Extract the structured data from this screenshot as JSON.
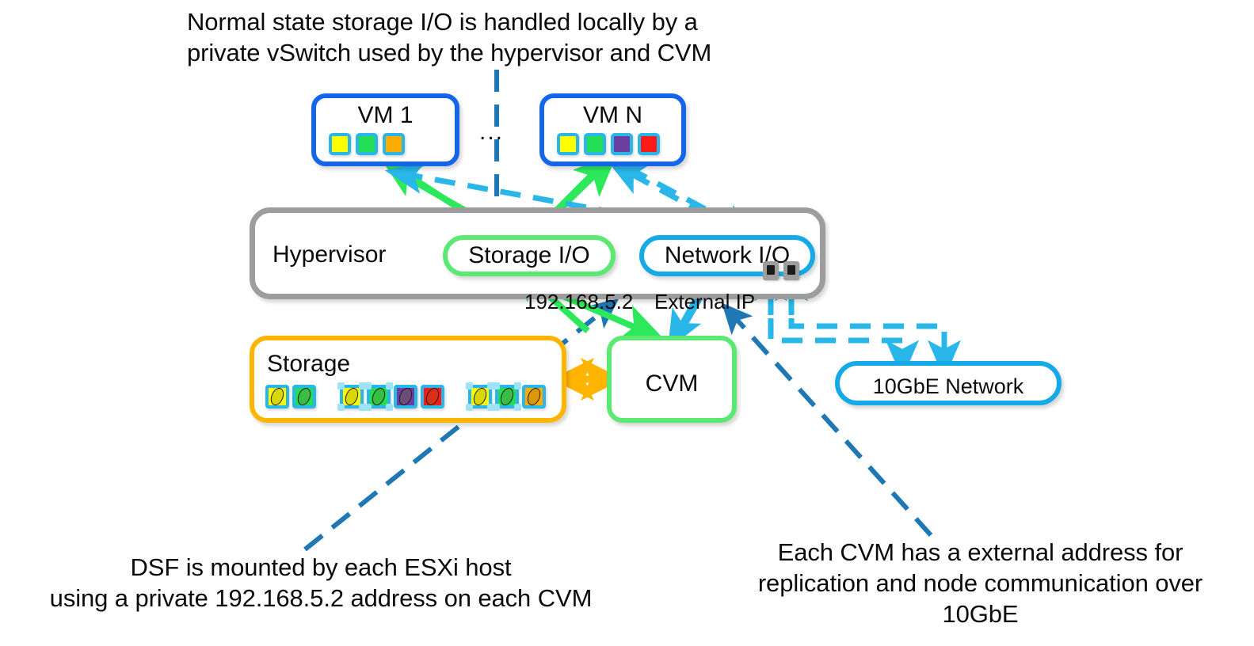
{
  "captions": {
    "top": "Normal state storage I/O is handled locally by a\nprivate vSwitch used by the hypervisor and CVM",
    "bottom_left": "DSF is mounted by each ESXi host\nusing a private 192.168.5.2 address on each CVM",
    "bottom_right": "Each CVM has a external address for\nreplication and node communication over\n10GbE"
  },
  "vms": [
    {
      "title": "VM 1",
      "chips": [
        "#FFFF00",
        "#22DD55",
        "#FFAA00"
      ]
    },
    {
      "title": "VM N",
      "chips": [
        "#FFFF00",
        "#22DD55",
        "#6B3FA0",
        "#FF1A1A"
      ]
    }
  ],
  "ellipsis": "...",
  "hypervisor": {
    "label": "Hypervisor",
    "storage_io": "Storage I/O",
    "network_io": "Network I/O",
    "nic_icon": "nic-port-icon"
  },
  "ip_labels": {
    "private": "192.168.5.2",
    "external": "External IP"
  },
  "storage": {
    "label": "Storage",
    "disk_groups": [
      {
        "disks": [
          {
            "color": "#FFFF00",
            "selected": false
          },
          {
            "color": "#22DD55",
            "selected": false
          }
        ]
      },
      {
        "disks": [
          {
            "color": "#FFFF00",
            "selected": true
          },
          {
            "color": "#22DD55",
            "selected": true
          },
          {
            "color": "#6B3FA0",
            "selected": false
          },
          {
            "color": "#FF1A1A",
            "selected": false
          }
        ]
      },
      {
        "disks": [
          {
            "color": "#FFFF00",
            "selected": true
          },
          {
            "color": "#22DD55",
            "selected": true
          },
          {
            "color": "#FFAA00",
            "selected": false
          }
        ]
      }
    ]
  },
  "cvm": {
    "label": "CVM"
  },
  "network": {
    "label": "10GbE Network"
  },
  "colors": {
    "vm_border": "#1565E8",
    "hypervisor_border": "#9D9D9D",
    "storage_io_border": "#5BE873",
    "network_io_border": "#16A9E8",
    "storage_border": "#FFB400",
    "cvm_border": "#5BE873",
    "net10g_border": "#16A9E8",
    "chip_border": "#29B6E8",
    "green_flow": "#2EE85C",
    "cyan_flow": "#29B6E8",
    "orange_flow": "#FFB400",
    "leader_blue": "#1F77B4",
    "text": "#0b0b0b"
  }
}
